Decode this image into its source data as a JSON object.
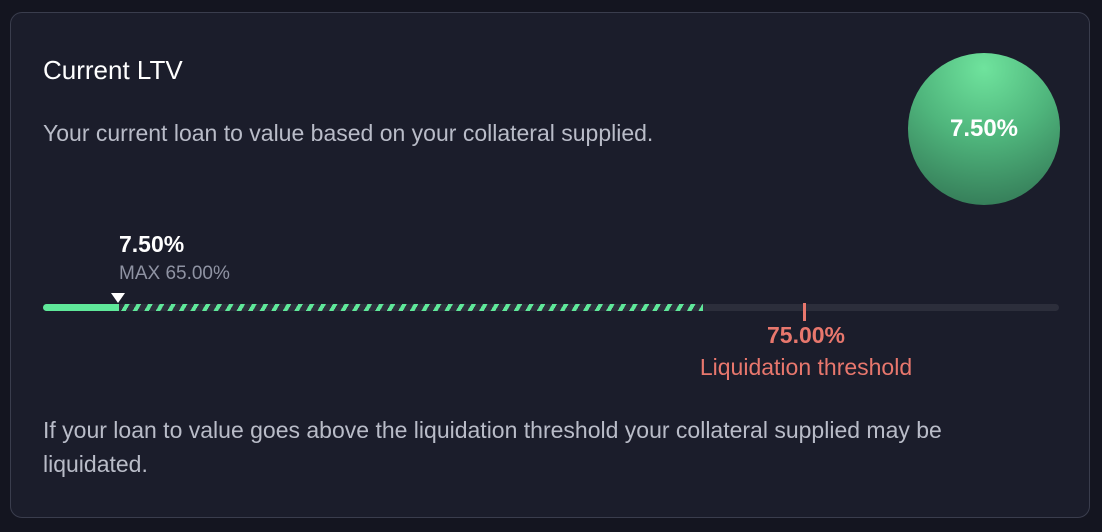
{
  "card": {
    "title": "Current LTV",
    "subtitle": "Your current loan to value based on your collateral supplied.",
    "badge_value": "7.50%"
  },
  "ltv_bar": {
    "current_value_label": "7.50%",
    "max_label": "MAX 65.00%",
    "current_percent": 7.5,
    "max_percent": 65.0,
    "liquidation_percent": 75.0,
    "scale_max_percent": 100.0,
    "liquidation_value_label": "75.00%",
    "liquidation_label": "Liquidation threshold"
  },
  "footnote": "If your loan to value goes above the liquidation threshold your collateral supplied may be liquidated.",
  "colors": {
    "accent_green": "#5fe89a",
    "danger_red": "#e8776d",
    "card_bg": "#1b1d2b",
    "track_bg": "#2c2e3b"
  },
  "icons": {
    "current_marker": "triangle-down-icon"
  }
}
